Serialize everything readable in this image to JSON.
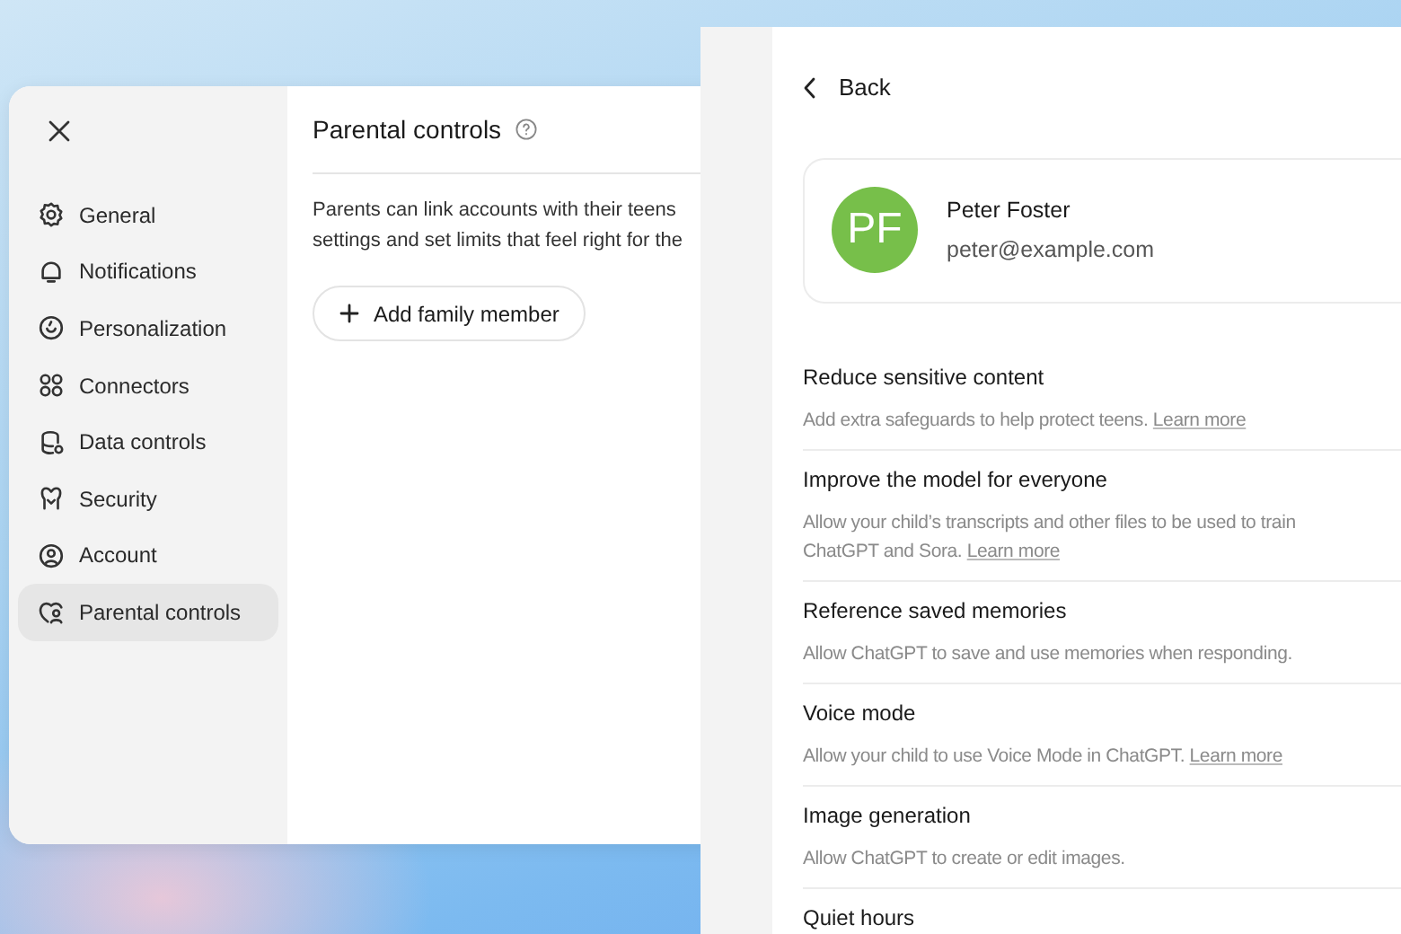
{
  "settings_window": {
    "nav_items": [
      {
        "label": "General",
        "selected": false
      },
      {
        "label": "Notifications",
        "selected": false
      },
      {
        "label": "Personalization",
        "selected": false
      },
      {
        "label": "Connectors",
        "selected": false
      },
      {
        "label": "Data controls",
        "selected": false
      },
      {
        "label": "Security",
        "selected": false
      },
      {
        "label": "Account",
        "selected": false
      },
      {
        "label": "Parental controls",
        "selected": true
      }
    ],
    "title": "Parental controls",
    "description_lines": [
      "Parents can link accounts with their teens",
      "settings and set limits that feel right for the"
    ],
    "add_button": "Add family member"
  },
  "member_panel": {
    "back": "Back",
    "member": {
      "initials": "PF",
      "name": "Peter Foster",
      "email": "peter@example.com"
    },
    "settings": [
      {
        "title": "Reduce sensitive content",
        "description_lines": [
          "Add extra safeguards to help protect teens."
        ],
        "link": "Learn more"
      },
      {
        "title": "Improve the model for everyone",
        "description_lines": [
          "Allow your child’s transcripts and other files to be used to train",
          "ChatGPT and Sora."
        ],
        "link": "Learn more"
      },
      {
        "title": "Reference saved memories",
        "description_lines": [
          "Allow ChatGPT to save and use memories when responding."
        ]
      },
      {
        "title": "Voice mode",
        "description_lines": [
          "Allow your child to use Voice Mode in ChatGPT."
        ],
        "link": "Learn more"
      },
      {
        "title": "Image generation",
        "description_lines": [
          "Allow ChatGPT to create or edit images."
        ]
      },
      {
        "title": "Quiet hours"
      }
    ]
  }
}
